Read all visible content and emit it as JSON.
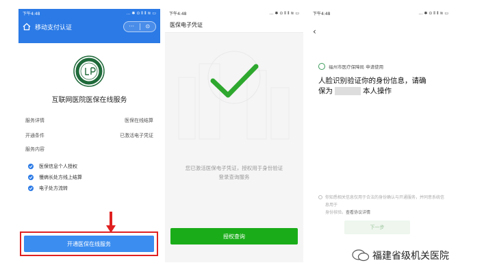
{
  "screen1": {
    "time": "下午4:48",
    "status_icons": "... ✱ ⊙ ⦀ ⦀ ≋ ▭",
    "nav_title": "移动支付认证",
    "capsule_more": "···",
    "capsule_close": "⊙",
    "hospital_title": "互联网医院医保在线服务",
    "rows": [
      {
        "label": "服务详情",
        "value": "医保在线结算"
      },
      {
        "label": "开通条件",
        "value": "已激活电子凭证"
      },
      {
        "label": "服务内容",
        "value": ""
      }
    ],
    "checks": [
      "医保信息个人授权",
      "慢病长处方线上结算",
      "电子处方流转"
    ],
    "button": "开通医保在线服务",
    "accent": "#2b7ae6",
    "highlight": "#e02020"
  },
  "screen2": {
    "time": "下午4:48",
    "status_icons": "... ✱ ⊙ ⦀ ⦀ ≋ ▭",
    "header": "医保电子凭证",
    "message_line1": "您已激活医保电子凭证，授权用于身份验证",
    "message_line2": "登录查询服务",
    "button": "授权查询",
    "accent": "#1aad19"
  },
  "screen3": {
    "time": "下午4:48",
    "status_icons": "... ✱ ⊙ ⦀ ⦀ ≋ ▭",
    "back": "‹",
    "source": "福州市医疗保障局 申请使用",
    "heading_a": "人脸识别验证你的身份信息，请确",
    "heading_b_pre": "保为",
    "heading_b_post": "本人操作",
    "agree_line1": "你知悉相关信息仅用于合法的身份确认与开通服务，并同意系统信息用于",
    "agree_line2": "身份核验。",
    "agree_link": "查看协议详情",
    "button": "下一步"
  },
  "watermark": "福建省级机关医院"
}
